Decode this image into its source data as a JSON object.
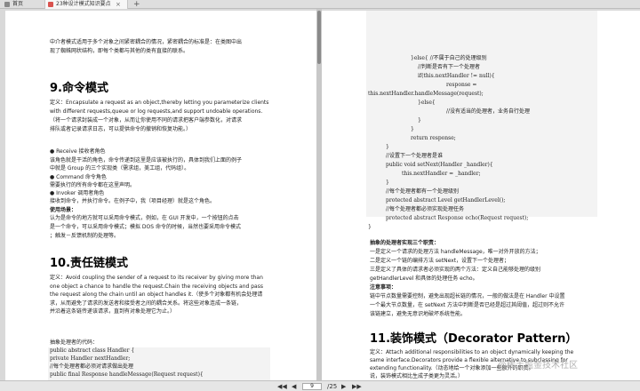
{
  "tabs": {
    "home": "首页",
    "doc": "23种设计模式知识要点",
    "close": "×",
    "add": "+"
  },
  "left": {
    "intro1": "中介者模式适用于多个对象之间紧密耦合的情况，紧密耦合的标准是：在类图中出",
    "intro2": "现了蜘蛛网状结构，即每个类都与其他的类有直接的联系。",
    "h9": "9.命令模式",
    "def9_1": "定义：Encapsulate a request as an object,thereby letting you parameterize clients",
    "def9_2": "with different requests,queue or log requests,and support undoable operations.",
    "def9_3": "（将一个请求封装成一个对象，从而让你使用不同的请求把客户端参数化，对请求",
    "def9_4": "排队或者记录请求日志，可以提供命令的撤销和恢复功能。）",
    "receiver": "● Receive 接收者角色",
    "receiver_d1": "该角色就是干活的角色，命令传递到这里是应该被执行的，具体到我们上面的例子",
    "receiver_d2": "中就是 Group 的三个实现类（需求组，美工组，代码组）。",
    "command": "● Command 命令角色",
    "command_d": "需要执行的所有命令都在这里声明。",
    "invoker": "● Invoker 调用者角色",
    "invoker_d": "接收到命令，并执行命令。在例子中，我（项目经理）就是这个角色。",
    "usage_h": "使用场景：",
    "usage1": "认为是命令的地方就可以采用命令模式，例如，在 GUI 开发中，一个按钮的点击",
    "usage2": "是一个命令，可以采用命令模式；模拟 DOS 命令的时候，当然也要采用命令模式",
    "usage3": "；触发－反馈机制的处理等。",
    "h10": "10.责任链模式",
    "def10_1": "定义：Avoid coupling the sender of a request to its receiver by giving more than",
    "def10_2": "one object a chance to handle the request.Chain the receiving objects and pass",
    "def10_3": "the request along the chain until an object handles it.（使多个对象都有机会处理请",
    "def10_4": "求，从而避免了请求的发送者和接受者之间的耦合关系。将这些对象连成一条链，",
    "def10_5": "并沿着这条链传递该请求，直到有对象处理它为止。）",
    "code_title": "抽象处理者的代码：",
    "code": [
      "public abstract class Handler {",
      "    private Handler nextHandler;",
      "    //每个处理者都必须对请求做出处理",
      "    public final Response handleMessage(Request request){"
    ]
  },
  "right": {
    "code": [
      "}else{  //不属于自己的处理级别",
      "    //判断是否有下一个处理者",
      "    if(this.nextHandler != null){",
      "        response =",
      "this.nextHandler.handleMessage(request);",
      "    }else{",
      "        //没有适当的处理者，业务自行处理",
      "    }",
      "}",
      "return response;",
      "}",
      "//设置下一个处理者是谁",
      "public void setNext(Handler _handler){",
      "    this.nextHandler = _handler;",
      "}",
      "//每个处理者都有一个处理级别",
      "protected abstract Level getHandlerLevel();",
      "//每个处理者都必须实现处理任务",
      "protected abstract Response echo(Request request);",
      "}"
    ],
    "duties_h": "抽象的处理者实现三个职责：",
    "duty1": "一是定义一个请求的处理方法 handleMessage，唯一对外开放的方法；",
    "duty2": "二是定义一个链的编排方法 setNext，设置下一个处理者；",
    "duty3a": "三是定义了具体的请求者必须实现的两个方法：定义自己能够处理的级别",
    "duty3b": "getHandlerLevel 和具体的处理任务 echo。",
    "note_h": "注意事项：",
    "note1": "链中节点数量需要控制，避免出现超长链的情况，一般的做法是在 Handler 中设置",
    "note2": "一个最大节点数量，在 setNext 方法中判断是否已经是超过其阈值，超过则不允许",
    "note3": "该链建立，避免无意识地破坏系统性能。",
    "h11": "11.装饰模式（Decorator Pattern）",
    "def11_1": "定义：Attach additional responsibilities to an object dynamically keeping the",
    "def11_2": "same interface.Decorators provide a flexible alternative to subclassing for",
    "def11_3": "extending functionality.（动态地给一个对象添加一些额外的职责。",
    "def11_4": "说，装饰模式相比生成子类更为灵活。）"
  },
  "status": {
    "first": "◀◀",
    "prev": "◀",
    "page": "9",
    "total": "/25",
    "next": "▶",
    "last": "▶▶"
  },
  "watermark": "@稀土掘金技术社区"
}
